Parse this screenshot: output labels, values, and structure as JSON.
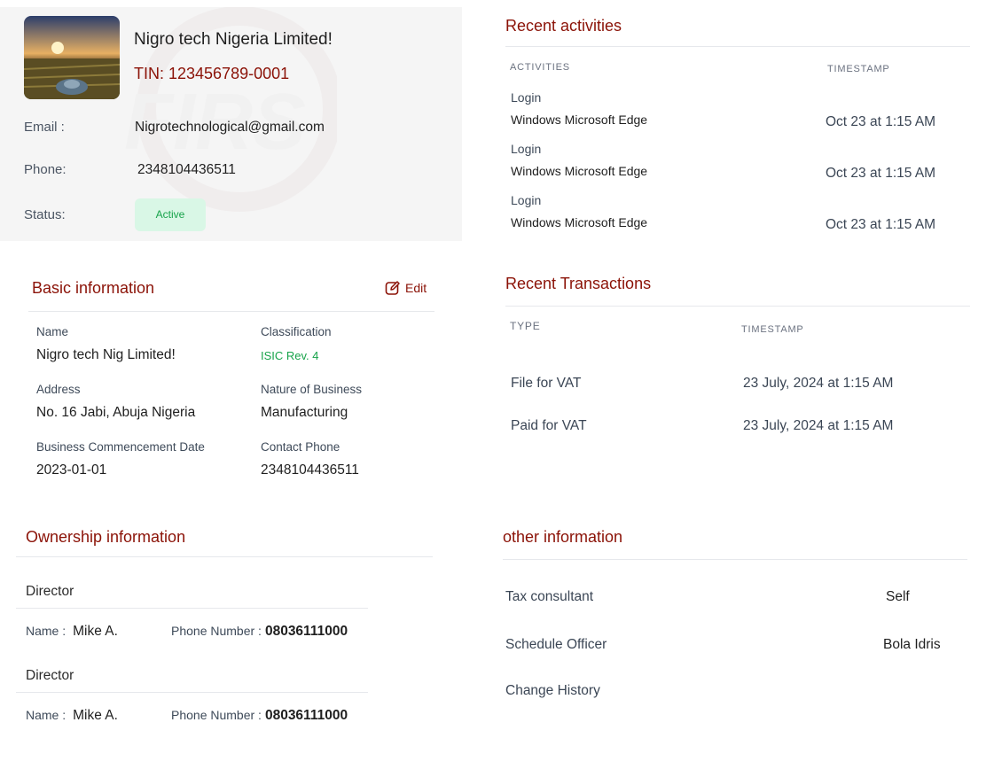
{
  "profile": {
    "company_name": "Nigro tech  Nigeria  Limited!",
    "tin": "TIN: 123456789-0001",
    "email_label": "Email :",
    "email": "Nigrotechnological@gmail.com",
    "phone_label": "Phone:",
    "phone": "2348104436511",
    "status_label": "Status:",
    "status": "Active"
  },
  "activities": {
    "title": "Recent activities",
    "col_activities": "ACTIVITIES",
    "col_timestamp": "TIMESTAMP",
    "rows": [
      {
        "action": "Login",
        "device": "Windows Microsoft Edge",
        "time": "Oct 23 at 1:15 AM"
      },
      {
        "action": "Login",
        "device": "Windows Microsoft Edge",
        "time": "Oct 23 at 1:15 AM"
      },
      {
        "action": "Login",
        "device": "Windows Microsoft Edge",
        "time": "Oct 23 at 1:15 AM"
      }
    ]
  },
  "basic": {
    "title": "Basic information",
    "edit": "Edit",
    "name_label": "Name",
    "name": "Nigro tech  Nig  Limited!",
    "classification_label": "Classification",
    "classification": "ISIC Rev. 4",
    "address_label": "Address",
    "address": "No. 16 Jabi, Abuja Nigeria",
    "nature_label": "Nature of Business",
    "nature": "Manufacturing",
    "commencement_label": "Business Commencement Date",
    "commencement": "2023-01-01",
    "contact_label": "Contact Phone",
    "contact": "2348104436511"
  },
  "transactions": {
    "title": "Recent Transactions",
    "col_type": "TYPE",
    "col_timestamp": "TIMESTAMP",
    "rows": [
      {
        "type": "File for VAT",
        "time": "23 July, 2024  at 1:15 AM"
      },
      {
        "type": "Paid for VAT",
        "time": "23 July, 2024  at 1:15 AM"
      }
    ]
  },
  "ownership": {
    "title": "Ownership information",
    "directors": [
      {
        "role": "Director",
        "name_label": "Name :",
        "name": "Mike  A.",
        "phone_label": "Phone Number :",
        "phone": "08036111000"
      },
      {
        "role": "Director",
        "name_label": "Name :",
        "name": "Mike  A.",
        "phone_label": "Phone Number :",
        "phone": "08036111000"
      }
    ]
  },
  "other": {
    "title": "other information",
    "tax_consultant_label": "Tax consultant",
    "tax_consultant": "Self",
    "schedule_officer_label": "Schedule Officer",
    "schedule_officer": "Bola Idris",
    "change_history": "Change History"
  },
  "colors": {
    "accent": "#8b1207",
    "active_bg": "#d9f7e6",
    "active_text": "#17a34a",
    "classification": "#17a34a"
  },
  "icons": {
    "edit": "edit-icon",
    "company_logo": "company-logo-image"
  }
}
